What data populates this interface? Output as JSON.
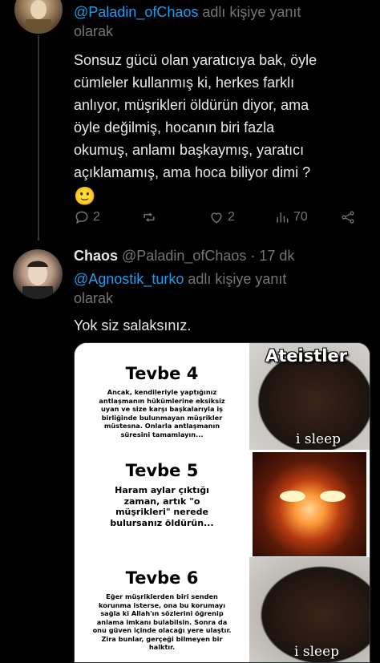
{
  "tweet1": {
    "reply_to_prefix": "@Paladin_ofChaos",
    "reply_to_suffix": " adlı kişiye yanıt",
    "reply_to_line2": "olarak",
    "text_lines": [
      "Sonsuz gücü olan yaratıcıya bak, öyle",
      "cümleler kullanmış ki, herkes farklı",
      "anlıyor, müşrikleri öldürün diyor, ama",
      "öyle değilmiş, hocanın biri fazla",
      "okumuş, anlamı başkaymış, yaratıcı",
      "açıklamamış, ama hoca biliyor dimi ?"
    ],
    "emoji": "🙂",
    "actions": {
      "reply_count": "2",
      "retweet_count": "",
      "like_count": "2",
      "views_count": "70"
    }
  },
  "tweet2": {
    "display_name": "Chaos",
    "handle": "@Paladin_ofChaos",
    "separator": " · ",
    "time": "17 dk",
    "reply_to_prefix": "@Agnostik_turko",
    "reply_to_suffix": " adlı kişiye yanıt",
    "reply_to_line2": "olarak",
    "text": "Yok siz salaksınız.",
    "meme": {
      "top_label": "Ateistler",
      "panels": [
        {
          "heading": "Tevbe 4",
          "body": "Ancak, kendileriyle yaptığınız antlaşmanın hükümlerine eksiksiz uyan ve size karşı başkalarıyla iş birliğinde bulunmayan müşrikler müstesna. Onlarla antlaşmanın süresini tamamlayın...",
          "caption": "i sleep"
        },
        {
          "heading": "Tevbe 5",
          "body": "Haram aylar çıktığı zaman, artık \"o müşrikleri\" nerede bulursanız öldürün...",
          "caption": ""
        },
        {
          "heading": "Tevbe 6",
          "body": "Eğer müşriklerden biri senden korunma isterse, ona bu korumayı sağla ki Allah'ın sözlerini öğrenip anlama imkanı bulabilsin. Sonra da onu güven içinde olacağı yere ulaştır. Zira bunlar, gerçeği bilmeyen bir halktır.",
          "caption": "i sleep"
        }
      ]
    }
  }
}
